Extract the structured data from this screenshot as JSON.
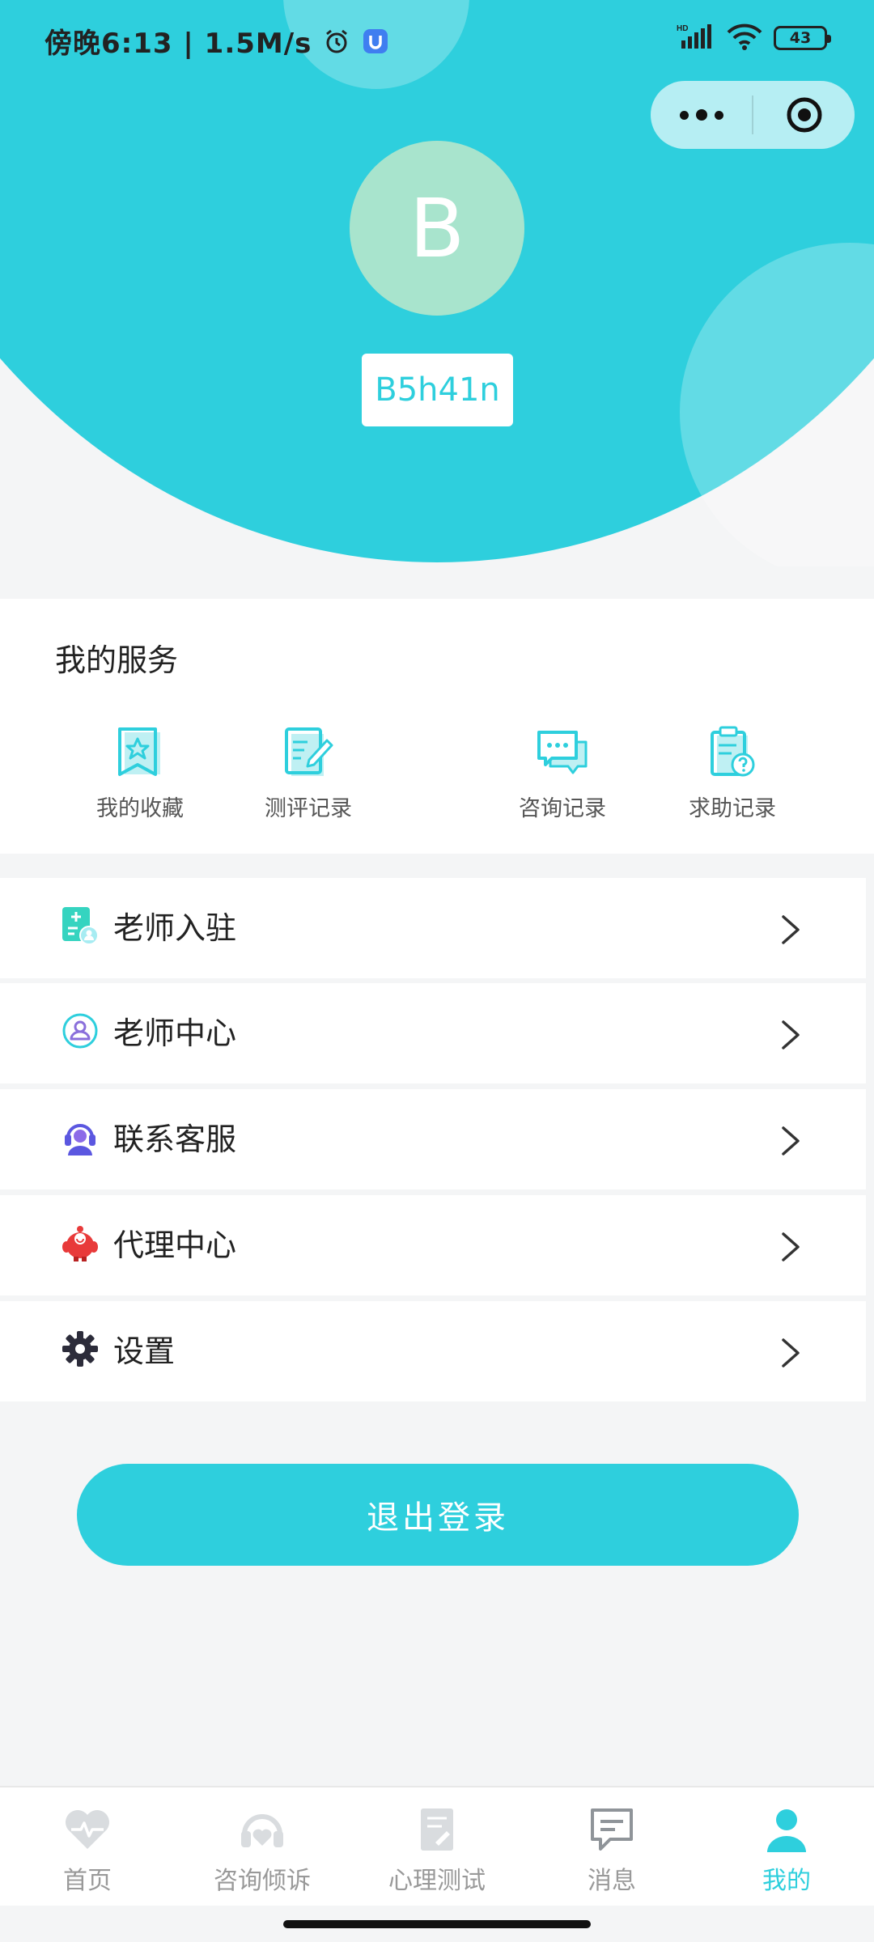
{
  "status_bar": {
    "time": "傍晚6:13 | 1.5M/s",
    "battery": "43"
  },
  "profile": {
    "avatar_letter": "B",
    "username": "B5h41n"
  },
  "services": {
    "title": "我的服务",
    "items": [
      {
        "label": "我的收藏",
        "icon": "bookmark-star-icon"
      },
      {
        "label": "测评记录",
        "icon": "edit-document-icon"
      },
      {
        "label": "咨询记录",
        "icon": "chat-bubbles-icon"
      },
      {
        "label": "求助记录",
        "icon": "clipboard-question-icon"
      }
    ]
  },
  "menu": [
    {
      "label": "老师入驻",
      "icon": "teacher-register-icon"
    },
    {
      "label": "老师中心",
      "icon": "teacher-profile-icon"
    },
    {
      "label": "联系客服",
      "icon": "headset-service-icon"
    },
    {
      "label": "代理中心",
      "icon": "agent-mascot-icon"
    },
    {
      "label": "设置",
      "icon": "gear-icon"
    }
  ],
  "logout_label": "退出登录",
  "tabs": [
    {
      "label": "首页",
      "icon": "heart-pulse-icon",
      "active": false
    },
    {
      "label": "咨询倾诉",
      "icon": "headphones-heart-icon",
      "active": false
    },
    {
      "label": "心理测试",
      "icon": "test-paper-icon",
      "active": false
    },
    {
      "label": "消息",
      "icon": "message-icon",
      "active": false
    },
    {
      "label": "我的",
      "icon": "user-icon",
      "active": true
    }
  ],
  "colors": {
    "accent": "#2ecfdd",
    "avatar_bg": "#a8e4cd",
    "page_bg": "#f4f5f6"
  }
}
